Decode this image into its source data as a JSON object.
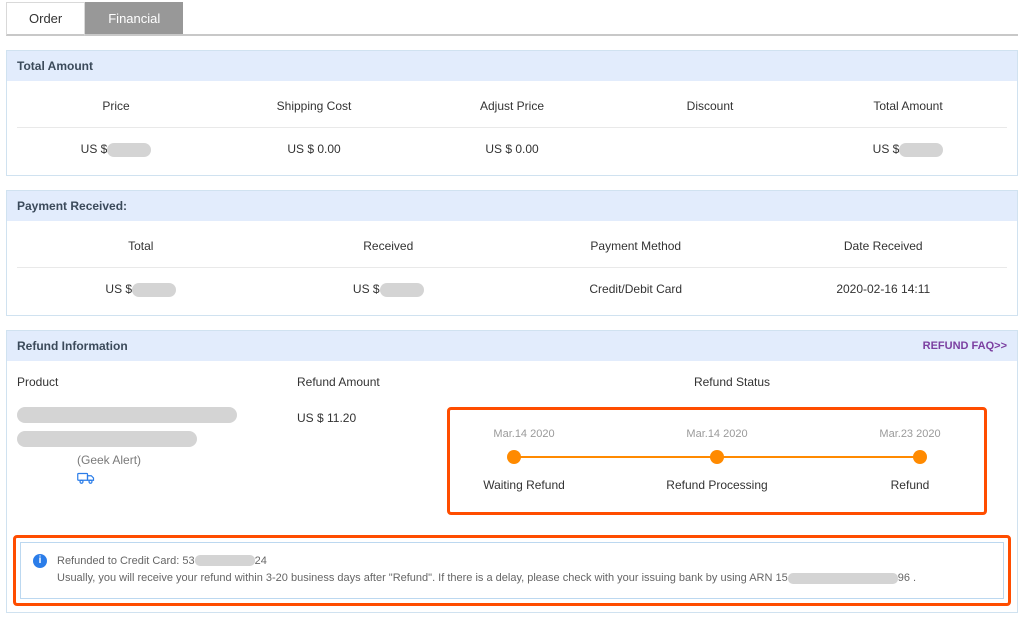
{
  "tabs": {
    "order": "Order",
    "financial": "Financial"
  },
  "total_amount": {
    "title": "Total Amount",
    "headers": {
      "price": "Price",
      "shipping": "Shipping Cost",
      "adjust": "Adjust Price",
      "discount": "Discount",
      "total": "Total Amount"
    },
    "values": {
      "price_prefix": "US $",
      "shipping": "US $ 0.00",
      "adjust": "US $ 0.00",
      "discount": "",
      "total_prefix": "US $"
    }
  },
  "payment_received": {
    "title": "Payment Received:",
    "headers": {
      "total": "Total",
      "received": "Received",
      "method": "Payment Method",
      "date": "Date Received"
    },
    "values": {
      "total_prefix": "US $",
      "received_prefix": "US $",
      "method": "Credit/Debit Card",
      "date": "2020-02-16 14:11"
    }
  },
  "refund": {
    "title": "Refund Information",
    "faq_label": "REFUND FAQ>>",
    "headers": {
      "product": "Product",
      "amount": "Refund Amount",
      "status": "Refund Status"
    },
    "product_name": "(Geek Alert)",
    "amount": "US $ 11.20",
    "steps": [
      {
        "date": "Mar.14 2020",
        "label": "Waiting Refund"
      },
      {
        "date": "Mar.14 2020",
        "label": "Refund Processing"
      },
      {
        "date": "Mar.23 2020",
        "label": "Refund"
      }
    ],
    "notice": {
      "line1_prefix": "Refunded to Credit Card: 53",
      "line1_suffix": "24",
      "line2_prefix": "Usually, you will receive your refund within 3-20 business days after \"Refund\". If there is a delay, please check with your issuing bank by using ARN 15",
      "line2_suffix": "96 ."
    }
  }
}
